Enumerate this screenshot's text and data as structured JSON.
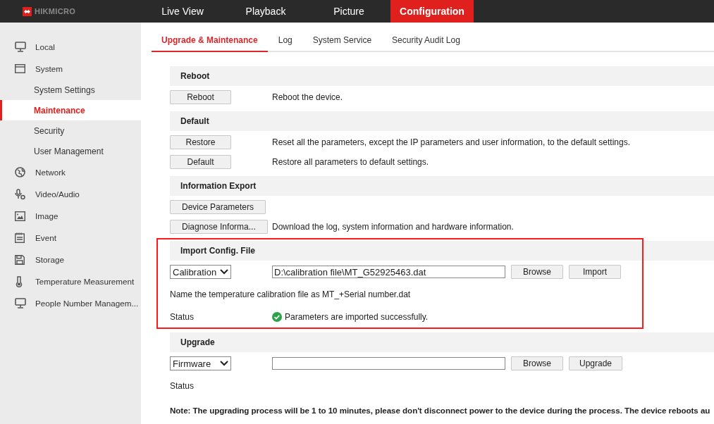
{
  "brand": "HIKMICRO",
  "nav": [
    {
      "label": "Live View",
      "selected": false
    },
    {
      "label": "Playback",
      "selected": false
    },
    {
      "label": "Picture",
      "selected": false
    },
    {
      "label": "Configuration",
      "selected": true
    }
  ],
  "sidebar": {
    "items": [
      {
        "label": "Local",
        "selected": false
      },
      {
        "label": "System",
        "selected": false,
        "children": [
          {
            "label": "System Settings",
            "selected": false
          },
          {
            "label": "Maintenance",
            "selected": true
          },
          {
            "label": "Security",
            "selected": false
          },
          {
            "label": "User Management",
            "selected": false
          }
        ]
      },
      {
        "label": "Network",
        "selected": false
      },
      {
        "label": "Video/Audio",
        "selected": false
      },
      {
        "label": "Image",
        "selected": false
      },
      {
        "label": "Event",
        "selected": false
      },
      {
        "label": "Storage",
        "selected": false
      },
      {
        "label": "Temperature Measurement",
        "selected": false
      },
      {
        "label": "People Number Managem...",
        "selected": false
      }
    ]
  },
  "tabs": [
    {
      "label": "Upgrade & Maintenance",
      "selected": true
    },
    {
      "label": "Log",
      "selected": false
    },
    {
      "label": "System Service",
      "selected": false
    },
    {
      "label": "Security Audit Log",
      "selected": false
    }
  ],
  "sections": [
    {
      "title": "Reboot",
      "highlighted": false,
      "rows": [
        {
          "kind": "button",
          "button": "Reboot",
          "description": "Reboot the device."
        }
      ]
    },
    {
      "title": "Default",
      "highlighted": false,
      "rows": [
        {
          "kind": "button",
          "button": "Restore",
          "description": "Reset all the parameters, except the IP parameters and user information, to the default settings."
        },
        {
          "kind": "button",
          "button": "Default",
          "description": "Restore all parameters to default settings."
        }
      ]
    },
    {
      "title": "Information Export",
      "highlighted": false,
      "rows": [
        {
          "kind": "button",
          "button": "Device Parameters"
        },
        {
          "kind": "button",
          "button": "Diagnose Informa...",
          "description": "Download the log, system information and hardware information."
        }
      ]
    },
    {
      "title": "Import Config. File",
      "highlighted": true,
      "rows": [
        {
          "kind": "file",
          "select": "Calibration",
          "path": "D:\\calibration file\\MT_G52925463.dat",
          "buttons": [
            "Browse",
            "Import"
          ]
        },
        {
          "kind": "text",
          "text": "Name the temperature calibration file as MT_+Serial number.dat"
        },
        {
          "kind": "status",
          "label": "Status",
          "message": "Parameters are imported successfully.",
          "success": true
        }
      ]
    },
    {
      "title": "Upgrade",
      "highlighted": false,
      "rows": [
        {
          "kind": "file",
          "select": "Firmware",
          "path": "",
          "buttons": [
            "Browse",
            "Upgrade"
          ]
        },
        {
          "kind": "status",
          "label": "Status"
        },
        {
          "kind": "note",
          "text": "Note: The upgrading process will be 1 to 10 minutes, please don't disconnect power to the device during the process. The device reboots au"
        }
      ]
    }
  ]
}
